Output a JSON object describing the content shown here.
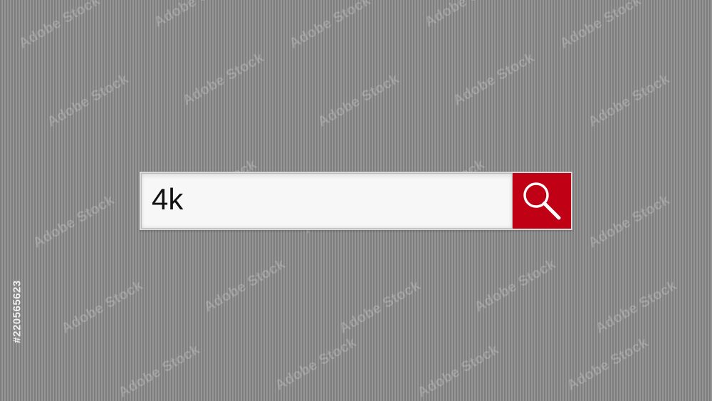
{
  "search": {
    "value": "4k",
    "button_icon": "search-icon"
  },
  "watermark": {
    "text": "Adobe Stock",
    "id": "#220565623"
  },
  "colors": {
    "background": "#8a8a8a",
    "button": "#c00014",
    "input_background": "#f7f7f7"
  }
}
